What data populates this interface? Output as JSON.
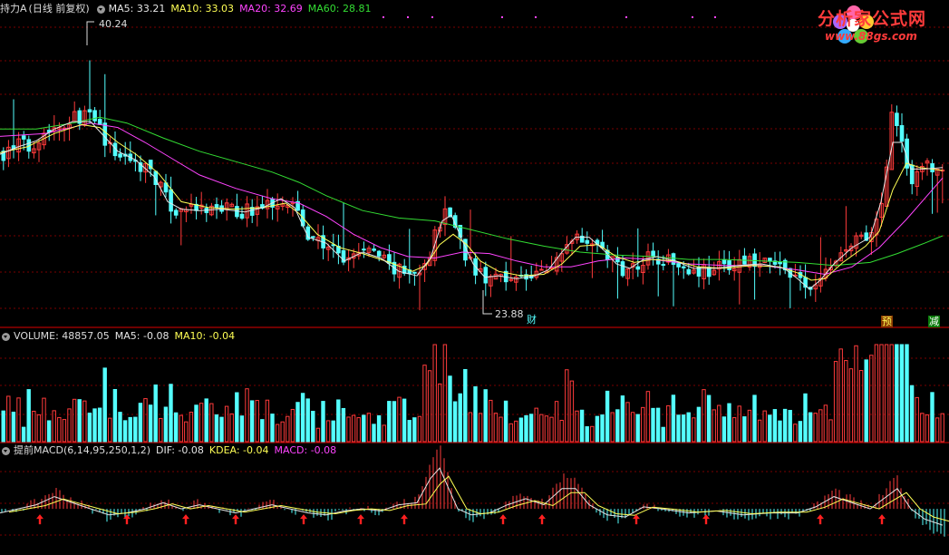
{
  "price_panel": {
    "title": "持力A",
    "mode": "(日线 前复权)",
    "indicators": [
      {
        "label": "MA5: 33.21",
        "color": "#e6e6e6"
      },
      {
        "label": "MA10: 33.03",
        "color": "#ffff55"
      },
      {
        "label": "MA20: 32.69",
        "color": "#ff44ff"
      },
      {
        "label": "MA60: 28.81",
        "color": "#33dd33"
      }
    ],
    "high_label": "40.24",
    "low_label": "23.88",
    "tags": {
      "cai": "财",
      "yu": "预",
      "jian": "减"
    }
  },
  "volume_panel": {
    "title": "VOLUME: 48857.05",
    "ma5": "MA5: -0.08",
    "ma10": "MA10: -0.04"
  },
  "macd_panel": {
    "title": "提前MACD(6,14,95,250,1,2)",
    "dif": "DIF: -0.08",
    "kdea": "KDEA: -0.04",
    "macd": "MACD: -0.08"
  },
  "logo": {
    "name": "分析家公式网",
    "url": "www.88gs.com"
  },
  "colors": {
    "up": "#ff3b3b",
    "down": "#54ffff",
    "ma5": "#e6e6e6",
    "ma10": "#ffff55",
    "ma20": "#ff44ff",
    "ma60": "#33dd33",
    "grid": "#7a0000",
    "border": "#b00000"
  },
  "chart_data": {
    "type": "candlestick",
    "price_range": [
      22.5,
      42.5
    ],
    "price_points": [
      [
        0,
        33.2
      ],
      [
        10,
        33.5
      ],
      [
        20,
        34.0
      ],
      [
        30,
        33.6
      ],
      [
        40,
        34.3
      ],
      [
        50,
        34.9
      ],
      [
        60,
        35.0
      ],
      [
        70,
        35.4
      ],
      [
        80,
        35.7
      ],
      [
        90,
        35.8
      ],
      [
        100,
        35.6
      ],
      [
        108,
        35.0
      ],
      [
        118,
        33.6
      ],
      [
        130,
        33.2
      ],
      [
        145,
        32.6
      ],
      [
        160,
        32.4
      ],
      [
        170,
        31.6
      ],
      [
        180,
        30.3
      ],
      [
        190,
        29.3
      ],
      [
        200,
        29.6
      ],
      [
        215,
        29.4
      ],
      [
        230,
        29.4
      ],
      [
        245,
        29.6
      ],
      [
        260,
        29.3
      ],
      [
        280,
        29.5
      ],
      [
        295,
        29.8
      ],
      [
        310,
        30.3
      ],
      [
        320,
        30.1
      ],
      [
        330,
        28.8
      ],
      [
        340,
        27.3
      ],
      [
        352,
        27.3
      ],
      [
        365,
        26.8
      ],
      [
        378,
        25.9
      ],
      [
        390,
        26.5
      ],
      [
        405,
        26.8
      ],
      [
        418,
        26.3
      ],
      [
        430,
        25.6
      ],
      [
        445,
        25.1
      ],
      [
        460,
        25.0
      ],
      [
        470,
        26.0
      ],
      [
        480,
        28.2
      ],
      [
        490,
        29.5
      ],
      [
        500,
        28.6
      ],
      [
        512,
        26.4
      ],
      [
        522,
        25.5
      ],
      [
        535,
        24.6
      ],
      [
        548,
        25.2
      ],
      [
        560,
        25.0
      ],
      [
        575,
        24.8
      ],
      [
        590,
        25.1
      ],
      [
        605,
        25.3
      ],
      [
        615,
        26.3
      ],
      [
        625,
        27.3
      ],
      [
        635,
        27.9
      ],
      [
        645,
        27.6
      ],
      [
        655,
        27.3
      ],
      [
        670,
        26.2
      ],
      [
        680,
        25.6
      ],
      [
        690,
        25.4
      ],
      [
        700,
        25.8
      ],
      [
        712,
        26.4
      ],
      [
        722,
        26.3
      ],
      [
        735,
        26.1
      ],
      [
        745,
        25.9
      ],
      [
        755,
        25.6
      ],
      [
        770,
        25.4
      ],
      [
        785,
        25.4
      ],
      [
        800,
        25.7
      ],
      [
        815,
        25.8
      ],
      [
        830,
        25.9
      ],
      [
        845,
        25.8
      ],
      [
        860,
        25.6
      ],
      [
        872,
        25.3
      ],
      [
        880,
        24.6
      ],
      [
        888,
        23.9
      ],
      [
        896,
        24.4
      ],
      [
        905,
        24.9
      ],
      [
        915,
        25.5
      ],
      [
        925,
        26.4
      ],
      [
        935,
        27.0
      ],
      [
        945,
        27.3
      ],
      [
        958,
        27.6
      ],
      [
        968,
        28.9
      ],
      [
        975,
        32.0
      ],
      [
        982,
        36.0
      ],
      [
        990,
        35.0
      ],
      [
        998,
        32.8
      ],
      [
        1006,
        31.3
      ],
      [
        1014,
        32.0
      ],
      [
        1022,
        32.4
      ],
      [
        1030,
        32.2
      ],
      [
        1040,
        32.2
      ]
    ],
    "ma5_points": [
      [
        0,
        33.2
      ],
      [
        20,
        33.7
      ],
      [
        40,
        34.1
      ],
      [
        60,
        34.9
      ],
      [
        80,
        35.4
      ],
      [
        100,
        35.4
      ],
      [
        115,
        34.4
      ],
      [
        130,
        33.4
      ],
      [
        150,
        32.8
      ],
      [
        170,
        31.7
      ],
      [
        185,
        30.0
      ],
      [
        200,
        29.5
      ],
      [
        220,
        29.4
      ],
      [
        245,
        29.5
      ],
      [
        270,
        29.3
      ],
      [
        290,
        29.6
      ],
      [
        310,
        30.2
      ],
      [
        325,
        29.6
      ],
      [
        340,
        27.6
      ],
      [
        360,
        27.2
      ],
      [
        380,
        26.0
      ],
      [
        400,
        26.6
      ],
      [
        420,
        26.2
      ],
      [
        440,
        25.3
      ],
      [
        460,
        25.0
      ],
      [
        475,
        26.2
      ],
      [
        488,
        28.7
      ],
      [
        498,
        29.1
      ],
      [
        510,
        27.4
      ],
      [
        522,
        25.8
      ],
      [
        535,
        24.9
      ],
      [
        550,
        25.0
      ],
      [
        570,
        24.8
      ],
      [
        590,
        25.0
      ],
      [
        605,
        25.4
      ],
      [
        620,
        26.6
      ],
      [
        635,
        27.6
      ],
      [
        650,
        27.6
      ],
      [
        665,
        26.8
      ],
      [
        680,
        25.8
      ],
      [
        695,
        25.5
      ],
      [
        710,
        26.1
      ],
      [
        725,
        26.3
      ],
      [
        745,
        26.0
      ],
      [
        765,
        25.5
      ],
      [
        790,
        25.5
      ],
      [
        815,
        25.7
      ],
      [
        840,
        25.8
      ],
      [
        865,
        25.5
      ],
      [
        880,
        24.8
      ],
      [
        893,
        24.1
      ],
      [
        905,
        24.7
      ],
      [
        920,
        25.8
      ],
      [
        940,
        26.9
      ],
      [
        960,
        27.6
      ],
      [
        972,
        30.0
      ],
      [
        985,
        34.0
      ],
      [
        995,
        34.0
      ],
      [
        1005,
        32.2
      ],
      [
        1020,
        32.2
      ],
      [
        1040,
        32.3
      ]
    ],
    "ma10_points": [
      [
        0,
        33.3
      ],
      [
        30,
        33.7
      ],
      [
        60,
        34.6
      ],
      [
        90,
        35.2
      ],
      [
        110,
        35.0
      ],
      [
        130,
        34.0
      ],
      [
        150,
        33.2
      ],
      [
        175,
        31.9
      ],
      [
        200,
        30.0
      ],
      [
        230,
        29.6
      ],
      [
        260,
        29.5
      ],
      [
        290,
        29.6
      ],
      [
        315,
        29.9
      ],
      [
        330,
        29.2
      ],
      [
        350,
        27.8
      ],
      [
        375,
        26.9
      ],
      [
        400,
        26.5
      ],
      [
        430,
        25.9
      ],
      [
        455,
        25.3
      ],
      [
        470,
        25.7
      ],
      [
        485,
        27.1
      ],
      [
        500,
        27.8
      ],
      [
        515,
        27.1
      ],
      [
        530,
        26.0
      ],
      [
        550,
        25.3
      ],
      [
        575,
        25.0
      ],
      [
        600,
        25.1
      ],
      [
        620,
        25.8
      ],
      [
        640,
        27.0
      ],
      [
        660,
        27.1
      ],
      [
        680,
        26.3
      ],
      [
        700,
        25.9
      ],
      [
        720,
        26.1
      ],
      [
        745,
        26.0
      ],
      [
        770,
        25.6
      ],
      [
        800,
        25.5
      ],
      [
        830,
        25.7
      ],
      [
        860,
        25.6
      ],
      [
        880,
        25.2
      ],
      [
        895,
        24.7
      ],
      [
        910,
        24.8
      ],
      [
        930,
        25.9
      ],
      [
        955,
        27.0
      ],
      [
        970,
        28.0
      ],
      [
        985,
        30.8
      ],
      [
        1000,
        32.6
      ],
      [
        1015,
        32.3
      ],
      [
        1040,
        32.1
      ]
    ],
    "ma20_points": [
      [
        0,
        34.4
      ],
      [
        50,
        34.6
      ],
      [
        100,
        35.3
      ],
      [
        130,
        35.0
      ],
      [
        160,
        34.0
      ],
      [
        190,
        32.9
      ],
      [
        220,
        31.8
      ],
      [
        260,
        30.9
      ],
      [
        300,
        30.2
      ],
      [
        330,
        29.9
      ],
      [
        360,
        29.0
      ],
      [
        390,
        27.8
      ],
      [
        420,
        26.9
      ],
      [
        450,
        26.3
      ],
      [
        480,
        26.2
      ],
      [
        510,
        26.6
      ],
      [
        540,
        26.5
      ],
      [
        570,
        26.0
      ],
      [
        600,
        25.6
      ],
      [
        630,
        25.6
      ],
      [
        660,
        26.0
      ],
      [
        690,
        26.2
      ],
      [
        720,
        26.1
      ],
      [
        760,
        25.8
      ],
      [
        800,
        25.7
      ],
      [
        840,
        25.7
      ],
      [
        880,
        25.4
      ],
      [
        910,
        25.1
      ],
      [
        940,
        25.6
      ],
      [
        970,
        26.9
      ],
      [
        1000,
        28.8
      ],
      [
        1020,
        30.2
      ],
      [
        1040,
        31.6
      ]
    ],
    "ma60_points": [
      [
        0,
        34.9
      ],
      [
        40,
        34.9
      ],
      [
        80,
        35.3
      ],
      [
        110,
        35.7
      ],
      [
        140,
        35.3
      ],
      [
        180,
        34.3
      ],
      [
        220,
        33.4
      ],
      [
        260,
        32.7
      ],
      [
        300,
        32.0
      ],
      [
        330,
        31.3
      ],
      [
        360,
        30.4
      ],
      [
        400,
        29.4
      ],
      [
        440,
        28.9
      ],
      [
        480,
        28.7
      ],
      [
        520,
        28.1
      ],
      [
        560,
        27.5
      ],
      [
        600,
        27.0
      ],
      [
        640,
        26.6
      ],
      [
        680,
        26.4
      ],
      [
        720,
        26.3
      ],
      [
        760,
        26.1
      ],
      [
        800,
        26.1
      ],
      [
        840,
        26.0
      ],
      [
        880,
        25.9
      ],
      [
        920,
        25.7
      ],
      [
        960,
        25.9
      ],
      [
        990,
        26.5
      ],
      [
        1020,
        27.2
      ],
      [
        1040,
        27.7
      ]
    ],
    "macd_dif_points": [
      [
        0,
        -0.02
      ],
      [
        20,
        0.0
      ],
      [
        40,
        0.02
      ],
      [
        60,
        0.06
      ],
      [
        80,
        0.03
      ],
      [
        100,
        0.0
      ],
      [
        120,
        -0.03
      ],
      [
        140,
        -0.02
      ],
      [
        160,
        0.0
      ],
      [
        180,
        0.03
      ],
      [
        200,
        0.0
      ],
      [
        220,
        0.02
      ],
      [
        240,
        0.0
      ],
      [
        260,
        -0.02
      ],
      [
        280,
        0.0
      ],
      [
        300,
        0.02
      ],
      [
        320,
        0.0
      ],
      [
        340,
        -0.02
      ],
      [
        360,
        -0.03
      ],
      [
        380,
        -0.01
      ],
      [
        400,
        0.0
      ],
      [
        420,
        -0.01
      ],
      [
        440,
        0.02
      ],
      [
        460,
        0.03
      ],
      [
        475,
        0.15
      ],
      [
        485,
        0.2
      ],
      [
        495,
        0.1
      ],
      [
        505,
        0.0
      ],
      [
        520,
        -0.03
      ],
      [
        540,
        -0.02
      ],
      [
        560,
        0.02
      ],
      [
        580,
        0.05
      ],
      [
        600,
        0.02
      ],
      [
        620,
        0.1
      ],
      [
        635,
        0.1
      ],
      [
        650,
        0.02
      ],
      [
        670,
        -0.03
      ],
      [
        690,
        -0.04
      ],
      [
        710,
        0.01
      ],
      [
        730,
        0.0
      ],
      [
        760,
        -0.02
      ],
      [
        790,
        -0.01
      ],
      [
        820,
        -0.03
      ],
      [
        850,
        -0.02
      ],
      [
        880,
        -0.02
      ],
      [
        900,
        0.01
      ],
      [
        920,
        0.06
      ],
      [
        940,
        0.03
      ],
      [
        960,
        0.0
      ],
      [
        975,
        0.05
      ],
      [
        990,
        0.1
      ],
      [
        1005,
        0.0
      ],
      [
        1020,
        -0.05
      ],
      [
        1040,
        -0.08
      ]
    ],
    "volume_scale": 1,
    "macd_range": [
      -0.2,
      0.25
    ]
  }
}
